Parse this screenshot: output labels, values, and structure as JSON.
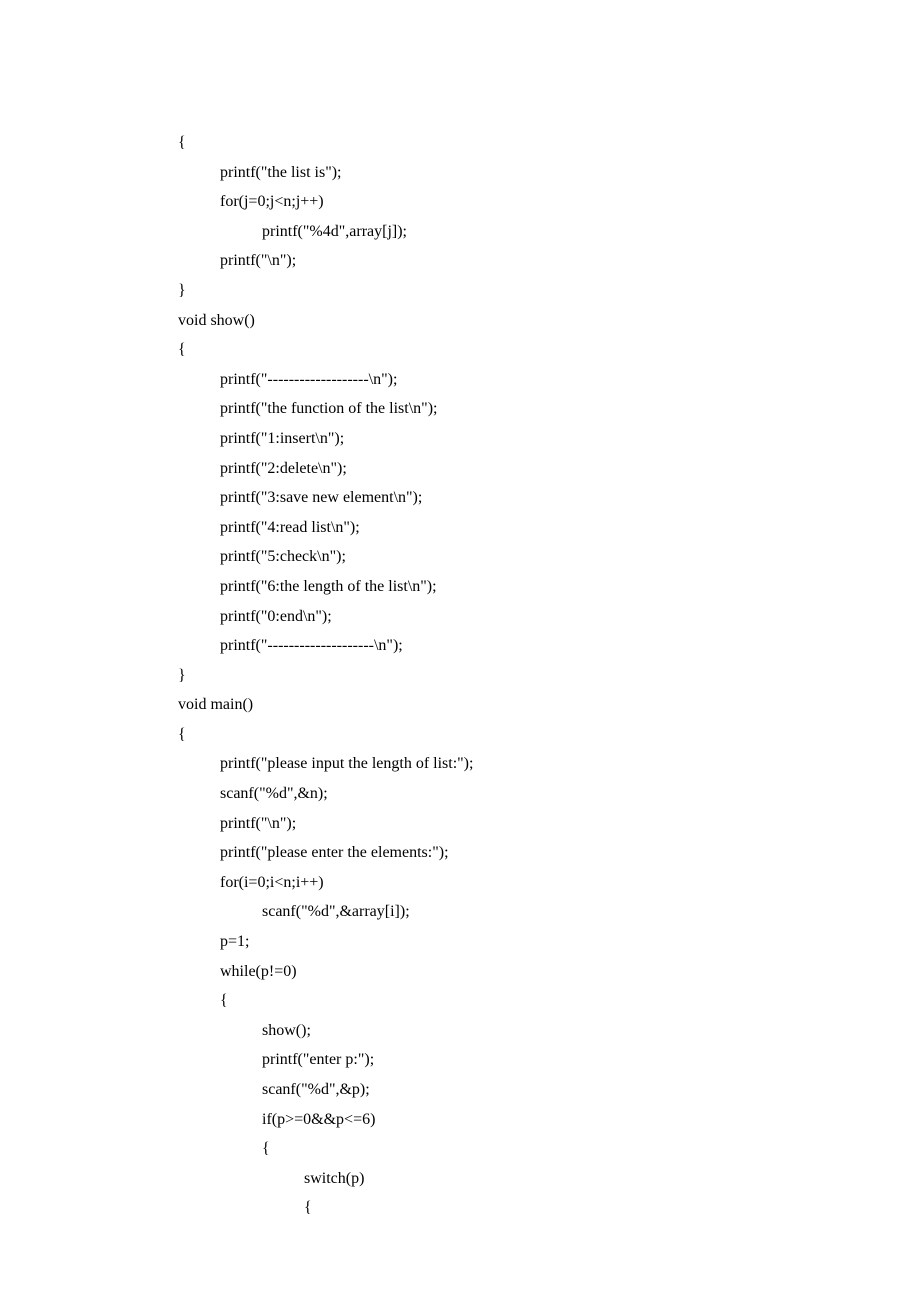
{
  "code": {
    "lines": [
      {
        "indent": 0,
        "text": "{"
      },
      {
        "indent": 1,
        "text": "printf(\"the list is\");"
      },
      {
        "indent": 1,
        "text": "for(j=0;j<n;j++)"
      },
      {
        "indent": 2,
        "text": "printf(\"%4d\",array[j]);"
      },
      {
        "indent": 1,
        "text": "printf(\"\\n\");"
      },
      {
        "indent": 0,
        "text": "}"
      },
      {
        "indent": 0,
        "text": "void show()"
      },
      {
        "indent": 0,
        "text": "{"
      },
      {
        "indent": 1,
        "text": "printf(\"-------------------\\n\");"
      },
      {
        "indent": 1,
        "text": "printf(\"the function of the list\\n\");"
      },
      {
        "indent": 1,
        "text": "printf(\"1:insert\\n\");"
      },
      {
        "indent": 1,
        "text": "printf(\"2:delete\\n\");"
      },
      {
        "indent": 1,
        "text": "printf(\"3:save new element\\n\");"
      },
      {
        "indent": 1,
        "text": "printf(\"4:read list\\n\");"
      },
      {
        "indent": 1,
        "text": "printf(\"5:check\\n\");"
      },
      {
        "indent": 1,
        "text": "printf(\"6:the length of the list\\n\");"
      },
      {
        "indent": 1,
        "text": "printf(\"0:end\\n\");"
      },
      {
        "indent": 1,
        "text": "printf(\"--------------------\\n\");"
      },
      {
        "indent": 0,
        "text": "}"
      },
      {
        "indent": 0,
        "text": "void main()"
      },
      {
        "indent": 0,
        "text": "{"
      },
      {
        "indent": 1,
        "text": "printf(\"please input the length of list:\");"
      },
      {
        "indent": 1,
        "text": "scanf(\"%d\",&n);"
      },
      {
        "indent": 1,
        "text": "printf(\"\\n\");"
      },
      {
        "indent": 1,
        "text": "printf(\"please enter the elements:\");"
      },
      {
        "indent": 1,
        "text": "for(i=0;i<n;i++)"
      },
      {
        "indent": 2,
        "text": "scanf(\"%d\",&array[i]);"
      },
      {
        "indent": 1,
        "text": "p=1;"
      },
      {
        "indent": 1,
        "text": "while(p!=0)"
      },
      {
        "indent": 1,
        "text": "{"
      },
      {
        "indent": 2,
        "text": "show();"
      },
      {
        "indent": 2,
        "text": "printf(\"enter p:\");"
      },
      {
        "indent": 2,
        "text": "scanf(\"%d\",&p);"
      },
      {
        "indent": 2,
        "text": "if(p>=0&&p<=6)"
      },
      {
        "indent": 2,
        "text": "{"
      },
      {
        "indent": 3,
        "text": "switch(p)"
      },
      {
        "indent": 3,
        "text": "{"
      }
    ]
  }
}
